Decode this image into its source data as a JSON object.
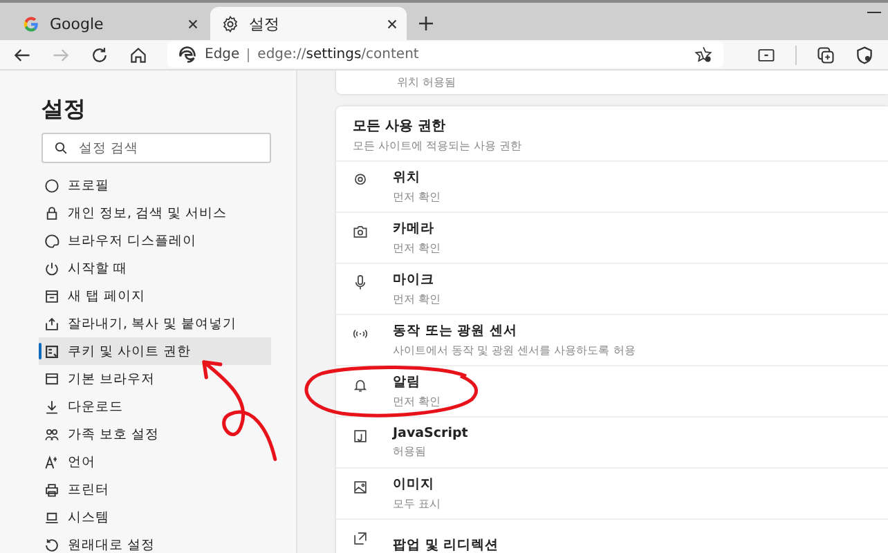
{
  "tabs": [
    {
      "label": "Google",
      "selected": false
    },
    {
      "label": "설정",
      "selected": true
    }
  ],
  "address_bar": {
    "brand": "Edge",
    "url_prefix": "edge://",
    "url_main": "settings",
    "url_suffix": "/content"
  },
  "sidebar": {
    "title": "설정",
    "search": {
      "placeholder": "설정 검색"
    },
    "items": [
      {
        "label": "프로필",
        "selected": false
      },
      {
        "label": "개인 정보, 검색 및 서비스",
        "selected": false
      },
      {
        "label": "브라우저 디스플레이",
        "selected": false
      },
      {
        "label": "시작할 때",
        "selected": false
      },
      {
        "label": "새 탭 페이지",
        "selected": false
      },
      {
        "label": "잘라내기, 복사 및 붙여넣기",
        "selected": false
      },
      {
        "label": "쿠키 및 사이트 권한",
        "selected": true
      },
      {
        "label": "기본 브라우저",
        "selected": false
      },
      {
        "label": "다운로드",
        "selected": false
      },
      {
        "label": "가족 보호 설정",
        "selected": false
      },
      {
        "label": "언어",
        "selected": false
      },
      {
        "label": "프린터",
        "selected": false
      },
      {
        "label": "시스템",
        "selected": false
      },
      {
        "label": "원래대로 설정",
        "selected": false
      }
    ]
  },
  "top_card": {
    "text": "위치 허용됨"
  },
  "permissions": {
    "title": "모든 사용 권한",
    "subtitle": "모든 사이트에 적용되는 사용 권한",
    "rows": [
      {
        "title": "위치",
        "status": "먼저 확인"
      },
      {
        "title": "카메라",
        "status": "먼저 확인"
      },
      {
        "title": "마이크",
        "status": "먼저 확인"
      },
      {
        "title": "동작 또는 광원 센서",
        "status": "사이트에서 동작 및 광원 센서를 사용하도록 허용"
      },
      {
        "title": "알림",
        "status": "먼저 확인"
      },
      {
        "title": "JavaScript",
        "status": "허용됨"
      },
      {
        "title": "이미지",
        "status": "모두 표시"
      },
      {
        "title": "팝업 및 리디렉션"
      }
    ]
  }
}
